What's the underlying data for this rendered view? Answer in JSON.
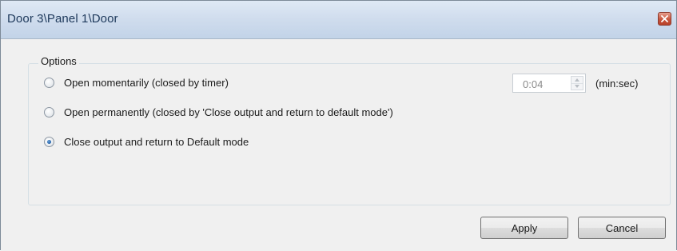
{
  "window": {
    "title": "Door 3\\Panel 1\\Door"
  },
  "options": {
    "legend": "Options",
    "radios": [
      {
        "label": "Open momentarily (closed by timer)",
        "checked": false
      },
      {
        "label": "Open permanently (closed by 'Close output and return to default mode')",
        "checked": false
      },
      {
        "label": "Close output and return to Default mode",
        "checked": true
      }
    ]
  },
  "timer": {
    "value": "0:04",
    "unit": "(min:sec)"
  },
  "buttons": {
    "apply": "Apply",
    "cancel": "Cancel"
  },
  "icons": {
    "close": "close-icon",
    "spin_up": "chevron-up-icon",
    "spin_down": "chevron-down-icon"
  },
  "colors": {
    "titlebar": "#cfdced",
    "title_text": "#1e395b",
    "close_button": "#c8553d",
    "radio_selected": "#1f5fa8",
    "background": "#f0f0f0"
  }
}
